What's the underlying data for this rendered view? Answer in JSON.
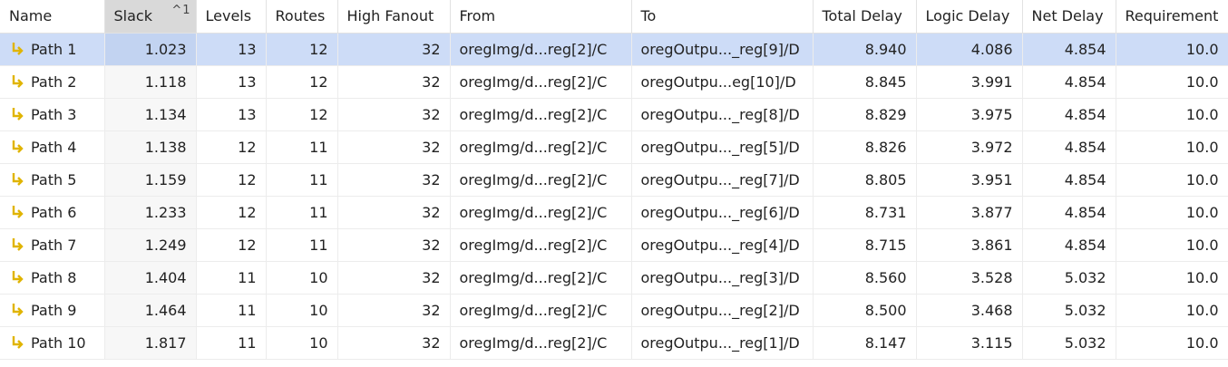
{
  "columns": {
    "name": "Name",
    "slack": "Slack",
    "levels": "Levels",
    "routes": "Routes",
    "high_fanout": "High Fanout",
    "from": "From",
    "to": "To",
    "total_delay": "Total Delay",
    "logic_delay": "Logic Delay",
    "net_delay": "Net Delay",
    "requirement": "Requirement"
  },
  "sort": {
    "column": "Slack",
    "direction": "ascending",
    "priority": "1",
    "arrow_glyph": "^"
  },
  "colors": {
    "selected_row": "#cddcf7",
    "sorted_header": "#d9d9d9",
    "path_icon": "#e0b400"
  },
  "icons": {
    "path": "path-arrow-icon"
  },
  "rows": [
    {
      "name": "Path 1",
      "slack": "1.023",
      "levels": "13",
      "routes": "12",
      "high_fanout": "32",
      "from": "oregImg/d...reg[2]/C",
      "to": "oregOutpu..._reg[9]/D",
      "total_delay": "8.940",
      "logic_delay": "4.086",
      "net_delay": "4.854",
      "requirement": "10.0",
      "selected": true
    },
    {
      "name": "Path 2",
      "slack": "1.118",
      "levels": "13",
      "routes": "12",
      "high_fanout": "32",
      "from": "oregImg/d...reg[2]/C",
      "to": "oregOutpu...eg[10]/D",
      "total_delay": "8.845",
      "logic_delay": "3.991",
      "net_delay": "4.854",
      "requirement": "10.0"
    },
    {
      "name": "Path 3",
      "slack": "1.134",
      "levels": "13",
      "routes": "12",
      "high_fanout": "32",
      "from": "oregImg/d...reg[2]/C",
      "to": "oregOutpu..._reg[8]/D",
      "total_delay": "8.829",
      "logic_delay": "3.975",
      "net_delay": "4.854",
      "requirement": "10.0"
    },
    {
      "name": "Path 4",
      "slack": "1.138",
      "levels": "12",
      "routes": "11",
      "high_fanout": "32",
      "from": "oregImg/d...reg[2]/C",
      "to": "oregOutpu..._reg[5]/D",
      "total_delay": "8.826",
      "logic_delay": "3.972",
      "net_delay": "4.854",
      "requirement": "10.0"
    },
    {
      "name": "Path 5",
      "slack": "1.159",
      "levels": "12",
      "routes": "11",
      "high_fanout": "32",
      "from": "oregImg/d...reg[2]/C",
      "to": "oregOutpu..._reg[7]/D",
      "total_delay": "8.805",
      "logic_delay": "3.951",
      "net_delay": "4.854",
      "requirement": "10.0"
    },
    {
      "name": "Path 6",
      "slack": "1.233",
      "levels": "12",
      "routes": "11",
      "high_fanout": "32",
      "from": "oregImg/d...reg[2]/C",
      "to": "oregOutpu..._reg[6]/D",
      "total_delay": "8.731",
      "logic_delay": "3.877",
      "net_delay": "4.854",
      "requirement": "10.0"
    },
    {
      "name": "Path 7",
      "slack": "1.249",
      "levels": "12",
      "routes": "11",
      "high_fanout": "32",
      "from": "oregImg/d...reg[2]/C",
      "to": "oregOutpu..._reg[4]/D",
      "total_delay": "8.715",
      "logic_delay": "3.861",
      "net_delay": "4.854",
      "requirement": "10.0"
    },
    {
      "name": "Path 8",
      "slack": "1.404",
      "levels": "11",
      "routes": "10",
      "high_fanout": "32",
      "from": "oregImg/d...reg[2]/C",
      "to": "oregOutpu..._reg[3]/D",
      "total_delay": "8.560",
      "logic_delay": "3.528",
      "net_delay": "5.032",
      "requirement": "10.0"
    },
    {
      "name": "Path 9",
      "slack": "1.464",
      "levels": "11",
      "routes": "10",
      "high_fanout": "32",
      "from": "oregImg/d...reg[2]/C",
      "to": "oregOutpu..._reg[2]/D",
      "total_delay": "8.500",
      "logic_delay": "3.468",
      "net_delay": "5.032",
      "requirement": "10.0"
    },
    {
      "name": "Path 10",
      "slack": "1.817",
      "levels": "11",
      "routes": "10",
      "high_fanout": "32",
      "from": "oregImg/d...reg[2]/C",
      "to": "oregOutpu..._reg[1]/D",
      "total_delay": "8.147",
      "logic_delay": "3.115",
      "net_delay": "5.032",
      "requirement": "10.0"
    }
  ]
}
